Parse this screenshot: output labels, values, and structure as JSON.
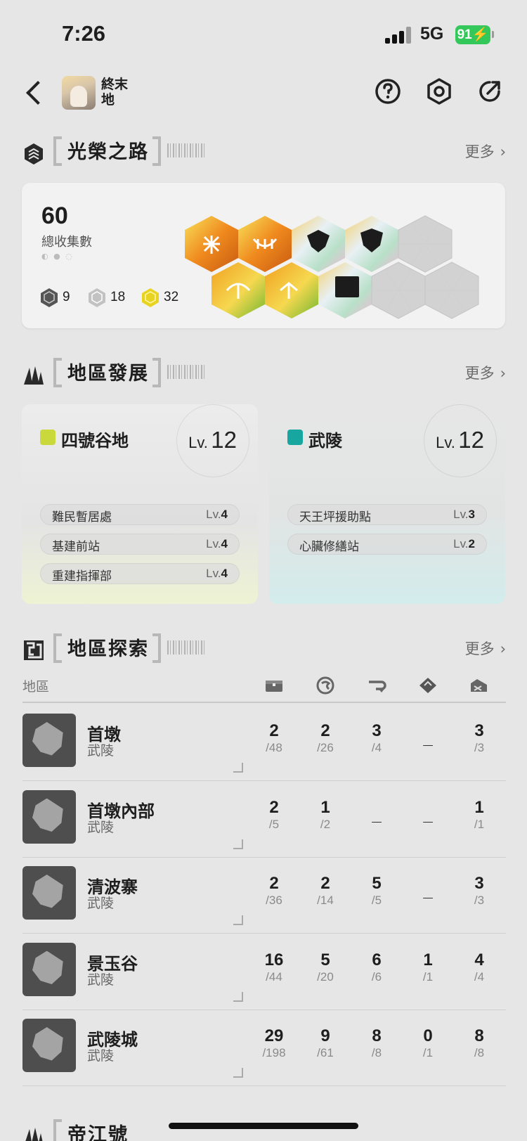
{
  "status_bar": {
    "time": "7:26",
    "network": "5G",
    "battery": "91"
  },
  "header": {
    "logo_text": "終末地"
  },
  "glory": {
    "title": "光榮之路",
    "more": "更多",
    "count": "60",
    "count_label": "總收集數",
    "medals": [
      {
        "name": "bronze",
        "count": "9",
        "color": "#555555"
      },
      {
        "name": "silver",
        "count": "18",
        "color": "#b8b8b8"
      },
      {
        "name": "gold",
        "count": "32",
        "color": "#e8d420"
      }
    ]
  },
  "development": {
    "title": "地區發展",
    "more": "更多",
    "regions": [
      {
        "name": "四號谷地",
        "lv_label": "Lv.",
        "level": "12",
        "badge_color": "#c9d83a",
        "facilities": [
          {
            "name": "難民暫居處",
            "lv_label": "Lv.",
            "level": "4"
          },
          {
            "name": "基建前站",
            "lv_label": "Lv.",
            "level": "4"
          },
          {
            "name": "重建指揮部",
            "lv_label": "Lv.",
            "level": "4"
          }
        ]
      },
      {
        "name": "武陵",
        "lv_label": "Lv.",
        "level": "12",
        "badge_color": "#18a6a0",
        "facilities": [
          {
            "name": "天王坪援助點",
            "lv_label": "Lv.",
            "level": "3"
          },
          {
            "name": "心臟修繕站",
            "lv_label": "Lv.",
            "level": "2"
          }
        ]
      }
    ]
  },
  "exploration": {
    "title": "地區探索",
    "more": "更多",
    "column_label": "地區",
    "column_icons": [
      "chest-icon",
      "coin-icon",
      "key-icon",
      "diamond-icon",
      "crate-icon"
    ],
    "areas": [
      {
        "name": "首墩",
        "region": "武陵",
        "stats": [
          [
            "2",
            "48"
          ],
          [
            "2",
            "26"
          ],
          [
            "3",
            "4"
          ],
          [
            "_",
            ""
          ],
          [
            "3",
            "3"
          ]
        ]
      },
      {
        "name": "首墩內部",
        "region": "武陵",
        "stats": [
          [
            "2",
            "5"
          ],
          [
            "1",
            "2"
          ],
          [
            "_",
            ""
          ],
          [
            "_",
            ""
          ],
          [
            "1",
            "1"
          ]
        ]
      },
      {
        "name": "清波寨",
        "region": "武陵",
        "stats": [
          [
            "2",
            "36"
          ],
          [
            "2",
            "14"
          ],
          [
            "5",
            "5"
          ],
          [
            "_",
            ""
          ],
          [
            "3",
            "3"
          ]
        ]
      },
      {
        "name": "景玉谷",
        "region": "武陵",
        "stats": [
          [
            "16",
            "44"
          ],
          [
            "5",
            "20"
          ],
          [
            "6",
            "6"
          ],
          [
            "1",
            "1"
          ],
          [
            "4",
            "4"
          ]
        ]
      },
      {
        "name": "武陵城",
        "region": "武陵",
        "stats": [
          [
            "29",
            "198"
          ],
          [
            "9",
            "61"
          ],
          [
            "8",
            "8"
          ],
          [
            "0",
            "1"
          ],
          [
            "8",
            "8"
          ]
        ]
      }
    ]
  },
  "next_section": {
    "title": "帝江號"
  }
}
